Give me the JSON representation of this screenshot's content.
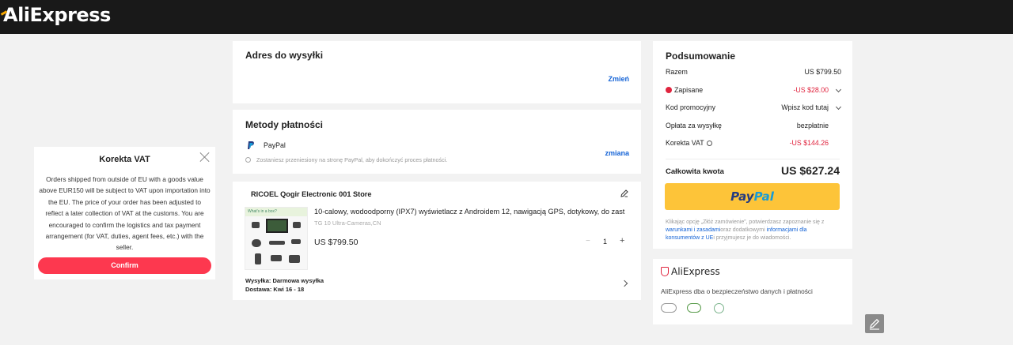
{
  "header": {
    "logo": "AliExpress"
  },
  "vat_popup": {
    "title": "Korekta VAT",
    "text": "Orders shipped from outside of EU with a goods value above EUR150 will be subject to VAT upon importation into the EU. The price of your order has been adjusted to reflect a later collection of VAT at the customs. You are encouraged to confirm the logistics and tax payment arrangement (for VAT, duties, agent fees, etc.) with the seller.",
    "confirm_label": "Confirm"
  },
  "address": {
    "title": "Adres do wysyłki",
    "change_label": "Zmień"
  },
  "payment": {
    "title": "Metody płatności",
    "method": "PayPal",
    "redirect_note": "Zostaniesz przeniesiony na stronę PayPal, aby dokończyć proces płatności.",
    "change_label": "zmiana"
  },
  "order": {
    "store": "RICOEL Qogir Electronic 001 Store",
    "product_title": "10-calowy, wodoodporny (IPX7) wyświetlacz z Androidem 12, nawigacją GPS, dotykowy, do zast",
    "variant": "TG 10 Ultra-Cameras,CN",
    "price": "US $799.50",
    "image_caption": "What's in a box?",
    "quantity": "1",
    "minus": "−",
    "plus": "+",
    "shipping": "Wysyłka: Darmowa wysyłka",
    "delivery": "Dostawa: Kwi 16 - 18"
  },
  "summary": {
    "title": "Podsumowanie",
    "subtotal_label": "Razem",
    "subtotal_value": "US $799.50",
    "saved_label": "Zapisane",
    "saved_value": "-US $28.00",
    "promo_label": "Kod promocyjny",
    "promo_value": "Wpisz kod tutaj",
    "shipping_label": "Opłata za wysyłkę",
    "shipping_value": "bezpłatnie",
    "vat_label": "Korekta VAT",
    "vat_value": "-US $144.26",
    "total_label": "Całkowita kwota",
    "total_value": "US $627.24",
    "paypal_button_a": "Pay",
    "paypal_button_b": "Pal",
    "terms_1": "Klikając opcję „Złóż zamówienie”, potwierdzasz zapoznanie się z ",
    "terms_link1": "warunkami i zasadami",
    "terms_2": "oraz dodatkowymi ",
    "terms_link2": "informacjami dla konsumentów z UE",
    "terms_3": "i przyjmujesz je do wiadomości."
  },
  "trust": {
    "logo": "AliExpress",
    "text": "AliExpress dba o bezpieczeństwo danych i płatności"
  },
  "colors": {
    "accent_red": "#fd384f",
    "link_blue": "#1463d6",
    "paypal_yellow": "#fdc439",
    "topbar": "#191919"
  }
}
